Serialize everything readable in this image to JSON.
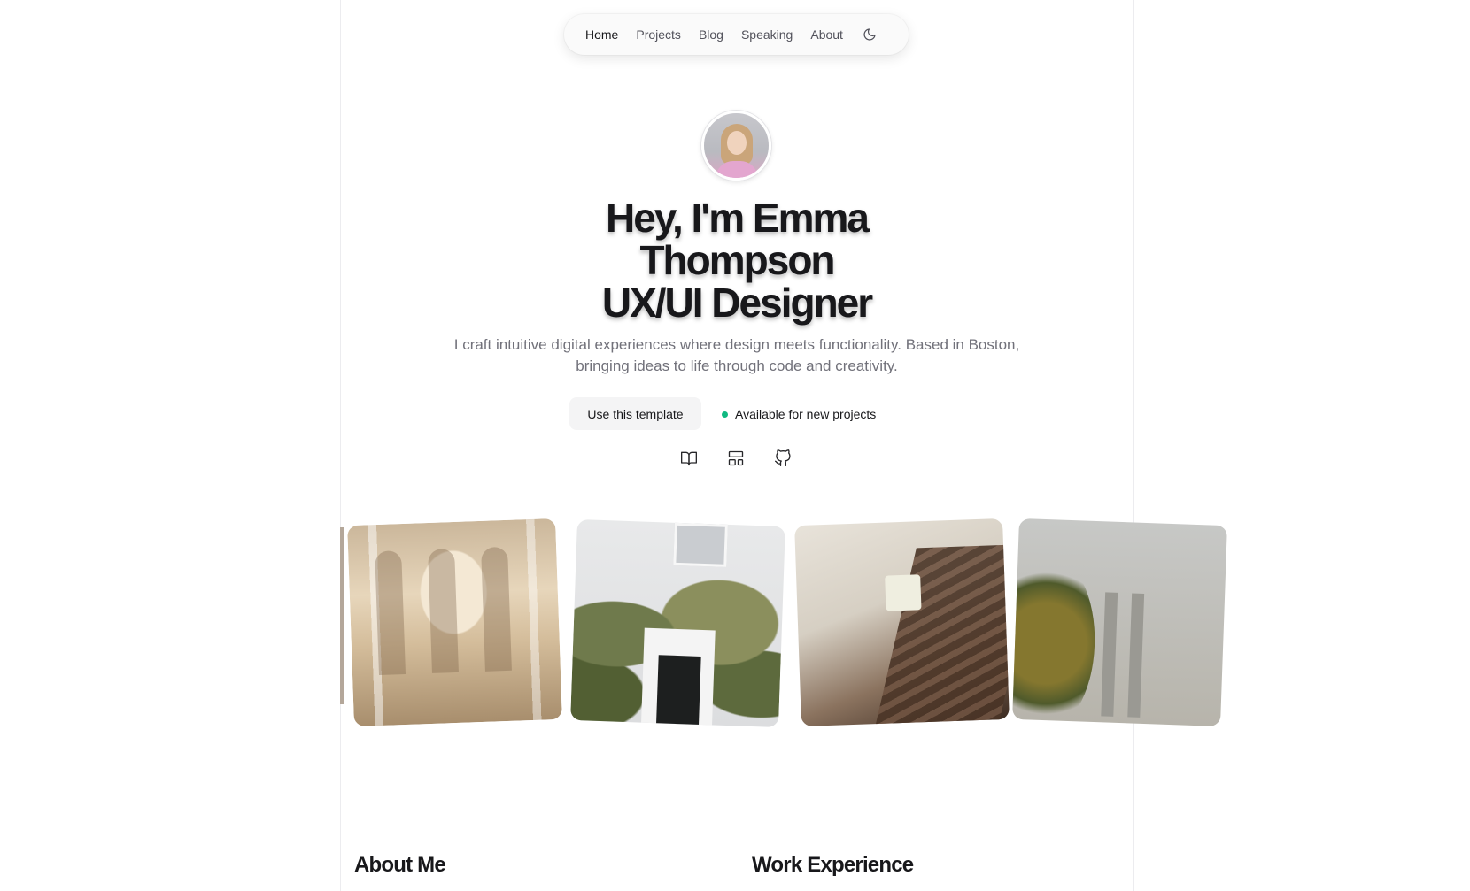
{
  "nav": {
    "items": [
      {
        "label": "Home",
        "active": true
      },
      {
        "label": "Projects",
        "active": false
      },
      {
        "label": "Blog",
        "active": false
      },
      {
        "label": "Speaking",
        "active": false
      },
      {
        "label": "About",
        "active": false
      }
    ],
    "theme_toggle_icon": "moon-icon"
  },
  "hero": {
    "title_line1": "Hey, I'm Emma",
    "title_line2": "Thompson",
    "title_line3": "UX/UI Designer",
    "subtitle": "I craft intuitive digital experiences where design meets functionality. Based in Boston, bringing ideas to life through code and creativity.",
    "cta_label": "Use this template",
    "status_label": "Available for new projects",
    "status_color": "#10b981"
  },
  "social": {
    "icons": [
      "book-open-icon",
      "layout-icon",
      "github-icon"
    ]
  },
  "sections": {
    "about_title": "About Me",
    "experience_title": "Work Experience"
  }
}
